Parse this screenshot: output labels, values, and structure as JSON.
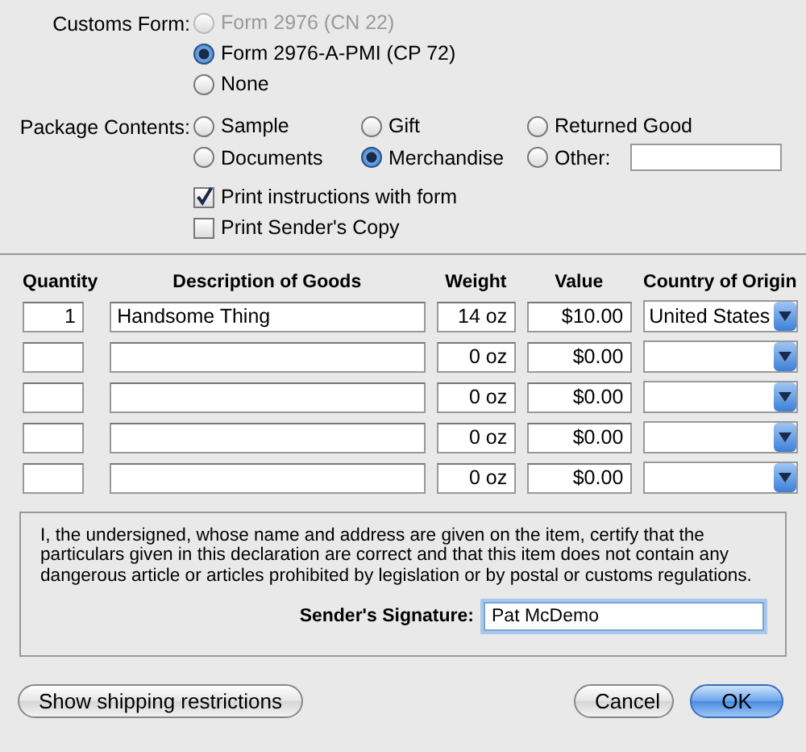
{
  "customs_form": {
    "label": "Customs Form:",
    "options": [
      {
        "label": "Form 2976 (CN 22)",
        "selected": false,
        "disabled": true
      },
      {
        "label": "Form 2976-A-PMI (CP 72)",
        "selected": true,
        "disabled": false
      },
      {
        "label": "None",
        "selected": false,
        "disabled": false
      }
    ]
  },
  "package_contents": {
    "label": "Package Contents:",
    "options": [
      {
        "label": "Sample",
        "selected": false
      },
      {
        "label": "Gift",
        "selected": false
      },
      {
        "label": "Returned Good",
        "selected": false
      },
      {
        "label": "Documents",
        "selected": false
      },
      {
        "label": "Merchandise",
        "selected": true
      },
      {
        "label": "Other:",
        "selected": false
      }
    ]
  },
  "print_options": [
    {
      "label": "Print instructions with form",
      "checked": true
    },
    {
      "label": "Print Sender's Copy",
      "checked": false
    }
  ],
  "table": {
    "columns": [
      "Quantity",
      "Description of Goods",
      "Weight",
      "Value",
      "Country of Origin"
    ],
    "rows": [
      {
        "quantity": "1",
        "description": "Handsome Thing",
        "weight": "14 oz",
        "value": "$10.00",
        "country": "United States"
      },
      {
        "weight": "0 oz",
        "value": "$0.00"
      },
      {
        "weight": "0 oz",
        "value": "$0.00"
      },
      {
        "weight": "0 oz",
        "value": "$0.00"
      },
      {
        "weight": "0 oz",
        "value": "$0.00"
      }
    ]
  },
  "declaration": {
    "text": "I, the undersigned, whose name and address are given on the item, certify that the particulars given in this declaration are correct and that this item does not contain any dangerous article or articles prohibited by legislation or by postal or customs regulations.",
    "signature_label": "Sender's Signature:",
    "signature_value": "Pat McDemo"
  },
  "buttons": [
    {
      "label": "Show shipping restrictions",
      "default": false
    },
    {
      "label": "Cancel",
      "default": false
    },
    {
      "label": "OK",
      "default": true
    }
  ]
}
